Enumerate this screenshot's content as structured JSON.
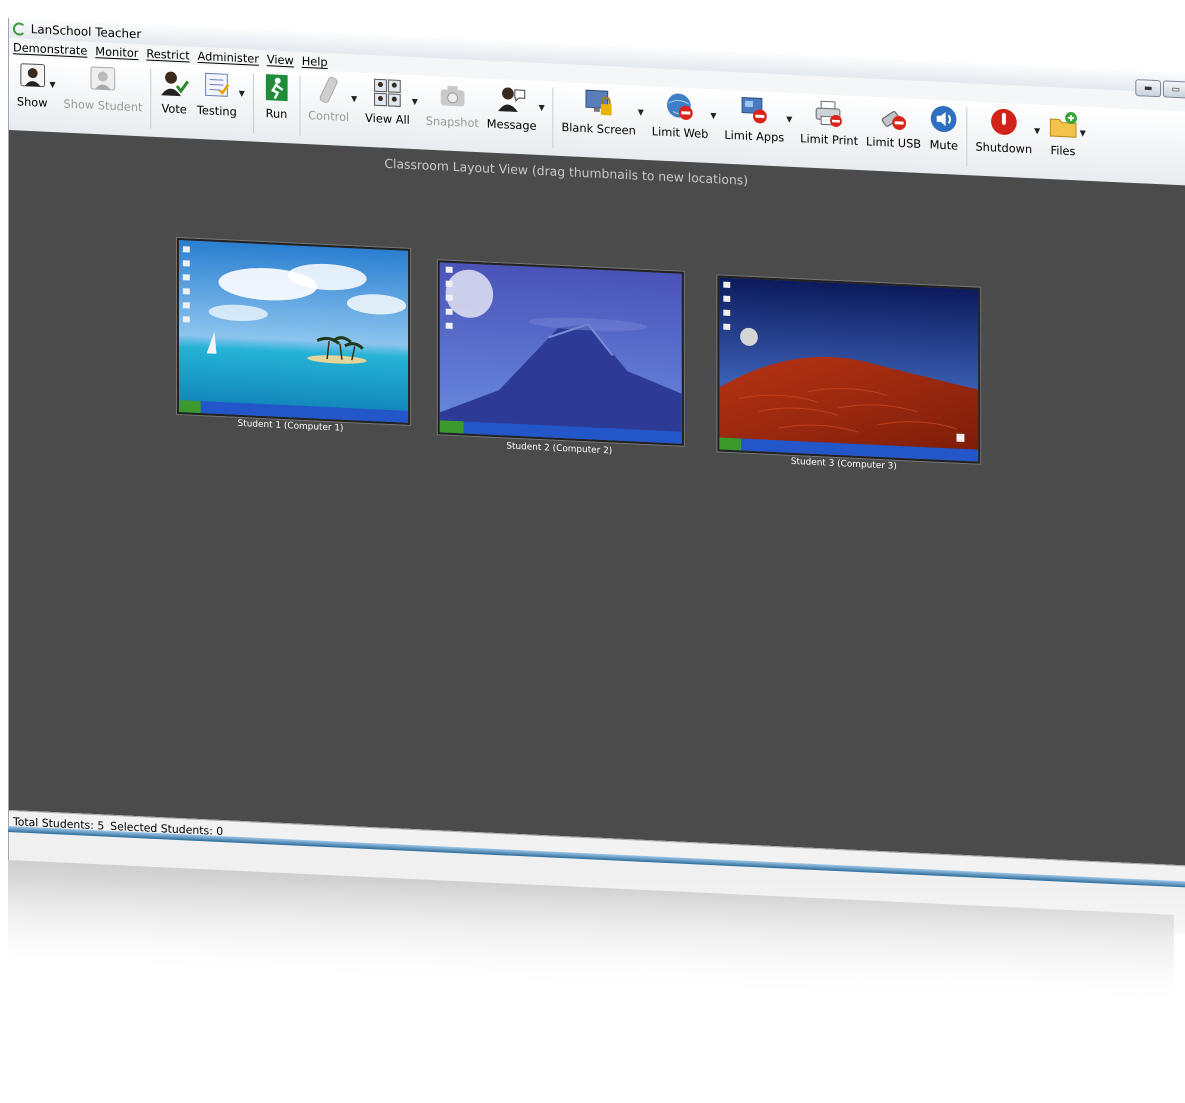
{
  "window": {
    "title": "LanSchool Teacher"
  },
  "menu": [
    "Demonstrate",
    "Monitor",
    "Restrict",
    "Administer",
    "View",
    "Help"
  ],
  "toolbar": {
    "show": "Show",
    "show_student": "Show Student",
    "vote": "Vote",
    "testing": "Testing",
    "run": "Run",
    "control": "Control",
    "view_all": "View All",
    "snapshot": "Snapshot",
    "message": "Message",
    "blank_screen": "Blank Screen",
    "limit_web": "Limit Web",
    "limit_apps": "Limit Apps",
    "limit_print": "Limit Print",
    "limit_usb": "Limit USB",
    "mute": "Mute",
    "shutdown": "Shutdown",
    "files": "Files"
  },
  "canvas": {
    "caption": "Classroom Layout View (drag thumbnails to new locations)"
  },
  "students": [
    {
      "label": "Student 1 (Computer 1)"
    },
    {
      "label": "Student 2 (Computer 2)"
    },
    {
      "label": "Student 3 (Computer 3)"
    }
  ],
  "status": {
    "total": "Total Students: 5",
    "selected": "Selected Students: 0"
  },
  "colors": {
    "canvas": "#4b4b4b",
    "toolbar": "#eef1f4",
    "accent": "#2b6b9a"
  }
}
